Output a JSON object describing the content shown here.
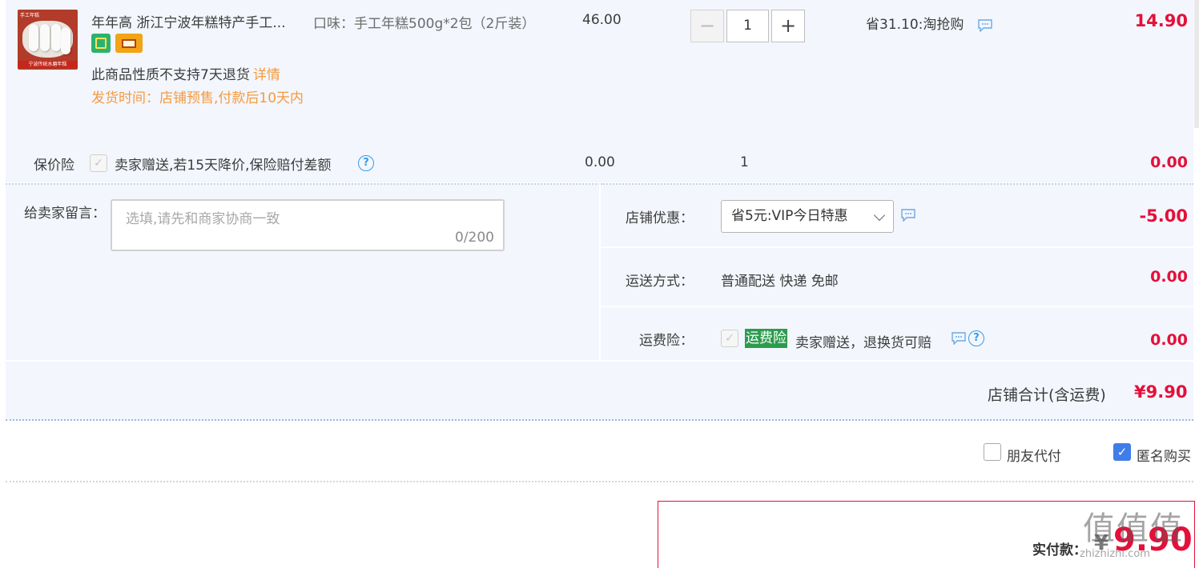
{
  "item": {
    "title": "年年高 浙江宁波年糕特产手工...",
    "thumb_tag": "手工年糕",
    "thumb_banner": "宁波传统水磨年糕",
    "no_return": "此商品性质不支持7天退货",
    "detail_link": "详情",
    "shipping": "发货时间：店铺预售,付款后10天内",
    "spec": "口味：手工年糕500g*2包（2斤装）",
    "unit_price": "46.00",
    "quantity": "1",
    "qty_minus": "−",
    "qty_plus": "+",
    "saving": "省31.10:淘抢购",
    "subtotal": "14.90"
  },
  "insurance": {
    "label": "保价险",
    "check": "✓",
    "text": "卖家赠送,若15天降价,保险赔付差额",
    "help": "?",
    "price": "0.00",
    "qty": "1",
    "subtotal": "0.00"
  },
  "message": {
    "label": "给卖家留言：",
    "placeholder": "选填,请先和商家协商一致",
    "counter": "0/200"
  },
  "shop_discount": {
    "label": "店铺优惠：",
    "selected": "省5元:VIP今日特惠",
    "value": "-5.00"
  },
  "delivery": {
    "label": "运送方式：",
    "text": "普通配送 快递 免邮",
    "value": "0.00"
  },
  "freight_insurance": {
    "label": "运费险：",
    "check": "✓",
    "tag": "运费险",
    "text": "卖家赠送，退换货可赔",
    "help": "?",
    "value": "0.00"
  },
  "shop_total": {
    "label": "店铺合计(含运费)",
    "value": "¥9.90"
  },
  "options": {
    "friend_pay": "朋友代付",
    "anonymous": "匿名购买",
    "anonymous_check": "✓"
  },
  "payment": {
    "label": "实付款：",
    "currency": "¥",
    "value": "9.90"
  },
  "watermark": {
    "logo": "值值值",
    "site": "zhizhizhi.com"
  },
  "colors": {
    "accent_red": "#e4103a",
    "orange": "#f59a3e",
    "panel_bg": "#f3f6fd",
    "green_tag": "#2b9c4d",
    "check_blue": "#3f7ee8"
  }
}
